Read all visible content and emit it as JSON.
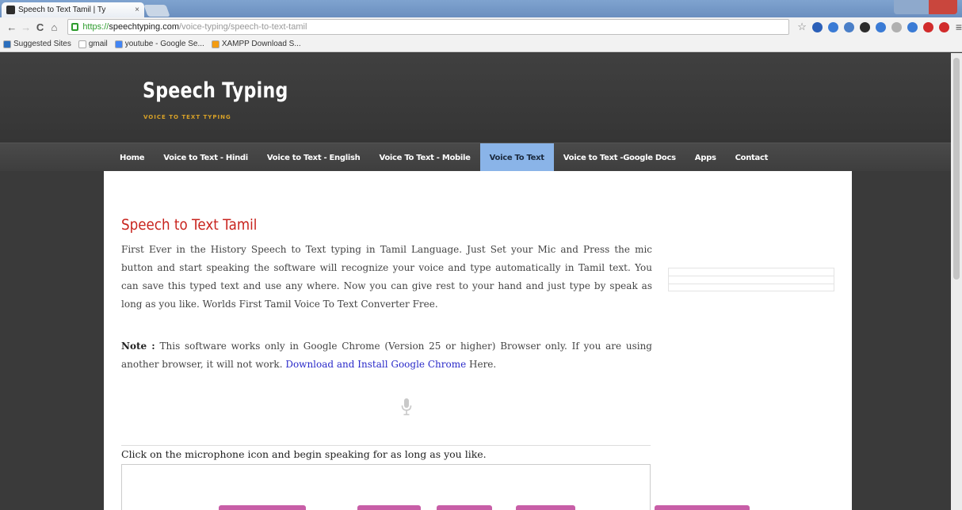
{
  "browser": {
    "tab_title": "Speech to Text Tamil | Ty",
    "tab_close": "×",
    "url_scheme": "https://",
    "url_domain": "speechtyping.com",
    "url_path": "/voice-typing/speech-to-text-tamil",
    "nav": {
      "back": "←",
      "forward": "→",
      "reload": "C",
      "home": "⌂"
    },
    "star": "☆",
    "menu": "≡",
    "extension_colors": [
      "#2a5fb8",
      "#3a7bd5",
      "#4a7fc8",
      "#2d2d2d",
      "#3a7bd5",
      "#b0b0b0",
      "#3a7bd5",
      "#d12b2b",
      "#d12b2b"
    ]
  },
  "bookmarks": [
    {
      "label": "Suggested Sites",
      "color": "#2a6ebd"
    },
    {
      "label": "gmail",
      "color": "#ffffff"
    },
    {
      "label": "youtube - Google Se...",
      "color": "#4285f4"
    },
    {
      "label": "XAMPP Download S...",
      "color": "#f39c12"
    }
  ],
  "site": {
    "title": "Speech Typing",
    "tagline": "VOICE TO TEXT TYPING"
  },
  "nav": {
    "items": [
      {
        "label": "Home"
      },
      {
        "label": "Voice to Text - Hindi"
      },
      {
        "label": "Voice to Text - English"
      },
      {
        "label": "Voice To Text - Mobile"
      },
      {
        "label": "Voice To Text",
        "active": true
      },
      {
        "label": "Voice to Text -Google Docs"
      },
      {
        "label": "Apps"
      },
      {
        "label": "Contact"
      }
    ]
  },
  "article": {
    "title": "Speech to Text Tamil",
    "body": "First Ever in the History Speech to Text typing in Tamil Language. Just Set your Mic and Press the mic button and start speaking the software will recognize your voice and type automatically in Tamil text. You can save this typed text and use any where. Now you can give rest to your hand and just type by speak as long as you like. Worlds First Tamil Voice To Text Converter Free.",
    "note_label": "Note :",
    "note_text": " This software works only in Google Chrome (Version 25 or higher) Browser only. If you are using another browser, it will not work. ",
    "note_link": "Download and Install Google Chrome",
    "note_tail": " Here.",
    "instructions": "Click on the microphone icon and begin speaking for as long as you like."
  }
}
